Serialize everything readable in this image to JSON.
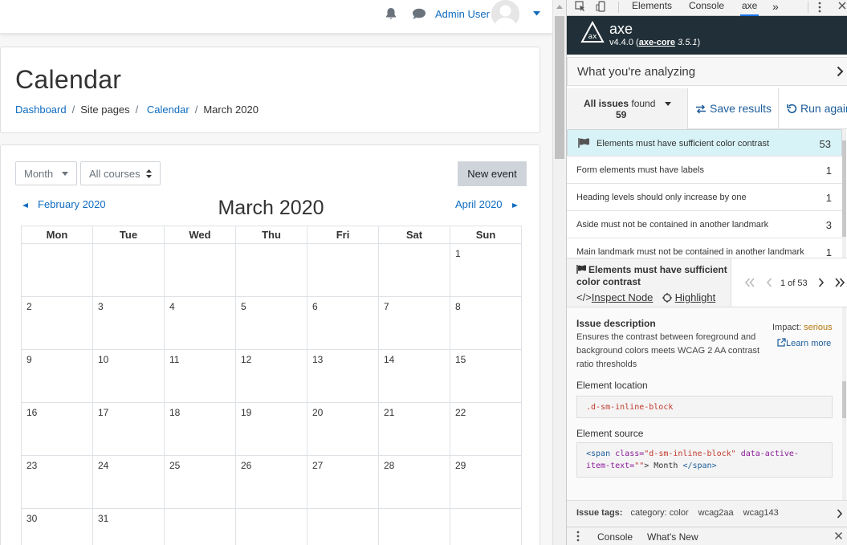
{
  "navbar": {
    "user_name": "Admin User"
  },
  "page": {
    "title": "Calendar",
    "breadcrumb": [
      "Dashboard",
      "Site pages",
      "Calendar",
      "March 2020"
    ]
  },
  "calendar": {
    "view_select": "Month",
    "course_select": "All courses",
    "new_event_label": "New event",
    "prev_month": "February 2020",
    "next_month": "April 2020",
    "title": "March 2020",
    "weekdays": [
      "Mon",
      "Tue",
      "Wed",
      "Thu",
      "Fri",
      "Sat",
      "Sun"
    ],
    "weeks": [
      [
        "",
        "",
        "",
        "",
        "",
        "",
        "1"
      ],
      [
        "2",
        "3",
        "4",
        "5",
        "6",
        "7",
        "8"
      ],
      [
        "9",
        "10",
        "11",
        "12",
        "13",
        "14",
        "15"
      ],
      [
        "16",
        "17",
        "18",
        "19",
        "20",
        "21",
        "22"
      ],
      [
        "23",
        "24",
        "25",
        "26",
        "27",
        "28",
        "29"
      ],
      [
        "30",
        "31",
        "",
        "",
        "",
        "",
        ""
      ]
    ]
  },
  "devtools": {
    "tabs": [
      "Elements",
      "Console",
      "axe"
    ],
    "active_tab": "axe",
    "drawer_tabs": [
      "Console",
      "What's New"
    ]
  },
  "axe": {
    "name": "axe",
    "version": "v4.4.0",
    "core_label": "axe-core",
    "core_version": "3.5.1",
    "analyzing_label": "What you're analyzing",
    "issues_filter_bold": "All issues",
    "issues_filter_rest": "found",
    "issues_count": "59",
    "save_results": "Save results",
    "run_again": "Run again",
    "issues": [
      {
        "title": "Elements must have sufficient color contrast",
        "count": "53"
      },
      {
        "title": "Form elements must have labels",
        "count": "1"
      },
      {
        "title": "Heading levels should only increase by one",
        "count": "1"
      },
      {
        "title": "Aside must not be contained in another landmark",
        "count": "3"
      },
      {
        "title": "Main landmark must not be contained in another landmark",
        "count": "1"
      }
    ],
    "detail": {
      "title": "Elements must have sufficient color contrast",
      "inspect_node": "Inspect Node",
      "highlight": "Highlight",
      "pager": "1 of 53",
      "description_title": "Issue description",
      "description": "Ensures the contrast between foreground and background colors meets WCAG 2 AA contrast ratio thresholds",
      "impact_label": "Impact:",
      "impact_value": "serious",
      "learn_more": "Learn more",
      "location_title": "Element location",
      "location": ".d-sm-inline-block",
      "source_title": "Element source",
      "source_tag_open": "<span",
      "source_attr1": "class=",
      "source_val1": "\"d-sm-inline-block\"",
      "source_attr2": "data-active-item-text=",
      "source_val2": "\"\"",
      "source_text": "> Month",
      "source_tag_close": "</span>"
    },
    "tags_label": "Issue tags:",
    "tags": [
      "category: color",
      "wcag2aa",
      "wcag143"
    ]
  },
  "colors": {
    "link": "#0f6cbf",
    "axe_header": "#213038",
    "selected_issue": "#d8f3f7",
    "impact_serious": "#b5760b"
  }
}
